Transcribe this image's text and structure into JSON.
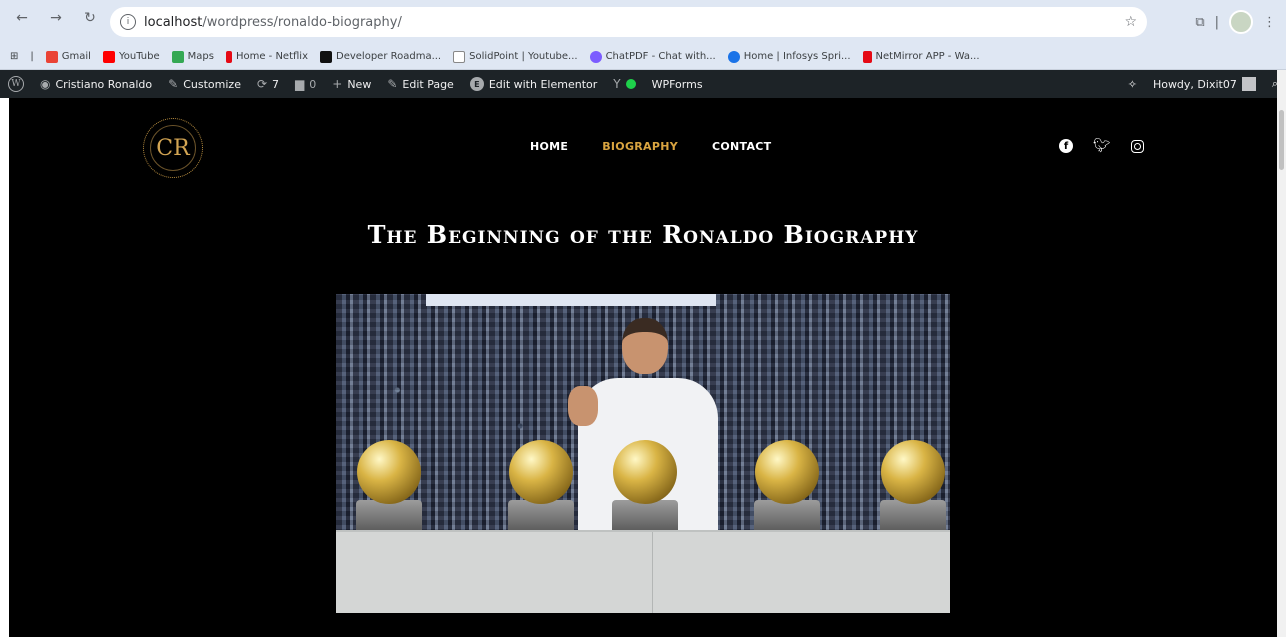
{
  "browser": {
    "url_host": "localhost",
    "url_path": "/wordpress/ronaldo-biography/"
  },
  "bookmarks": [
    {
      "label": "Gmail",
      "color": "#ea4335"
    },
    {
      "label": "YouTube",
      "color": "#ff0000"
    },
    {
      "label": "Maps",
      "color": "#34a853"
    },
    {
      "label": "Home - Netflix",
      "color": "#e50914"
    },
    {
      "label": "Developer Roadma...",
      "color": "#111111"
    },
    {
      "label": "SolidPoint | Youtube...",
      "color": "#ffffff"
    },
    {
      "label": "ChatPDF - Chat with...",
      "color": "#7b5cff"
    },
    {
      "label": "Home | Infosys Spri...",
      "color": "#1a73e8"
    },
    {
      "label": "NetMirror APP - Wa...",
      "color": "#e50914"
    }
  ],
  "wpbar": {
    "site": "Cristiano Ronaldo",
    "customize": "Customize",
    "updates": "7",
    "comments": "0",
    "new": "New",
    "edit_page": "Edit Page",
    "elementor": "Edit with Elementor",
    "wpforms": "WPForms",
    "howdy": "Howdy, Dixit07"
  },
  "site": {
    "logo_text": "CR",
    "menu": [
      {
        "label": "HOME",
        "active": false
      },
      {
        "label": "BIOGRAPHY",
        "active": true
      },
      {
        "label": "CONTACT",
        "active": false
      }
    ],
    "title": "The Beginning of the Ronaldo Biography",
    "accent": "#d9a440"
  }
}
